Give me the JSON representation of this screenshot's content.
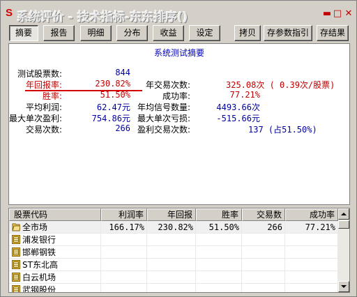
{
  "window": {
    "logo": "S",
    "title": "系统评价 - 技术指标-东东排序()"
  },
  "toolbar": {
    "tabs": [
      "摘要",
      "报告",
      "明细",
      "分布",
      "收益",
      "设定"
    ],
    "actions": [
      "拷贝",
      "存参数指引",
      "存结果"
    ]
  },
  "summary": {
    "title": "系统测试摘要",
    "left": [
      {
        "label": "测试股票数:",
        "value": "844"
      },
      {
        "label": "年回报率:",
        "value": "230.82%"
      },
      {
        "label": "胜率:",
        "value": "51.50%"
      },
      {
        "label": "平均利润:",
        "value": "62.47元"
      },
      {
        "label": "最大单次盈利:",
        "value": "754.86元"
      },
      {
        "label": "交易次数:",
        "value": "266"
      }
    ],
    "right": [
      {
        "label": "年交易次数:",
        "value": "325.08次 ( 0.39次/股票)"
      },
      {
        "label": "成功率:",
        "value": "77.21%"
      },
      {
        "label": "年均信号数量:",
        "value": "4493.66次"
      },
      {
        "label": "最大单次亏损:",
        "value": "-515.66元"
      },
      {
        "label": "盈利交易次数:",
        "value": "137 (占51.50%)"
      }
    ]
  },
  "table": {
    "columns": [
      "股票代码",
      "利润率",
      "年回报",
      "胜率",
      "交易数",
      "成功率"
    ],
    "rows": [
      [
        "全市场",
        "166.17%",
        "230.82%",
        "51.50%",
        "266",
        "77.21%"
      ],
      [
        "浦发银行",
        "",
        "",
        "",
        "",
        ""
      ],
      [
        "邯郸钢铁",
        "",
        "",
        "",
        "",
        ""
      ],
      [
        "ST东北高",
        "",
        "",
        "",
        "",
        ""
      ],
      [
        "白云机场",
        "",
        "",
        "",
        "",
        ""
      ],
      [
        "武钢股份",
        "",
        "",
        "",
        "",
        ""
      ]
    ]
  },
  "colors": {
    "label_red": "#c00000",
    "value_blue": "#0000a0",
    "title_blue": "#0000c0",
    "underline_red": "#d40000"
  }
}
